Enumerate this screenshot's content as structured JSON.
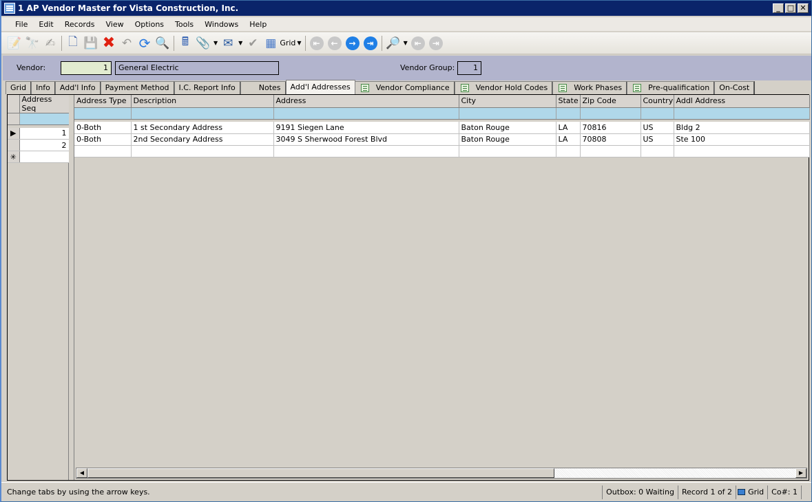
{
  "window": {
    "title": "1 AP Vendor Master for Vista Construction, Inc.",
    "minimize": "_",
    "maximize": "□",
    "close": "✕"
  },
  "menu": [
    "File",
    "Edit",
    "Records",
    "View",
    "Options",
    "Tools",
    "Windows",
    "Help"
  ],
  "toolbar": {
    "grid_label": "Grid"
  },
  "header": {
    "vendor_label": "Vendor:",
    "vendor_number": "1",
    "vendor_name": "General Electric",
    "vendor_group_label": "Vendor Group:",
    "vendor_group": "1"
  },
  "tabs": [
    {
      "label": "Grid",
      "icon": false,
      "active": false
    },
    {
      "label": "Info",
      "icon": false,
      "active": false
    },
    {
      "label": "Add'l Info",
      "icon": false,
      "active": false
    },
    {
      "label": "Payment Method",
      "icon": false,
      "active": false
    },
    {
      "label": "I.C. Report Info",
      "icon": false,
      "active": false
    },
    {
      "label": "Notes",
      "icon": false,
      "active": false
    },
    {
      "label": "Add'l Addresses",
      "icon": false,
      "active": true
    },
    {
      "label": "Vendor Compliance",
      "icon": true,
      "active": false
    },
    {
      "label": "Vendor Hold Codes",
      "icon": true,
      "active": false
    },
    {
      "label": "Work Phases",
      "icon": true,
      "active": false
    },
    {
      "label": "Pre-qualification",
      "icon": true,
      "active": false
    },
    {
      "label": "On-Cost",
      "icon": false,
      "active": false
    }
  ],
  "grid": {
    "frozen_columns": [
      "Address Seq"
    ],
    "columns": [
      "Address Type",
      "Description",
      "Address",
      "City",
      "State",
      "Zip Code",
      "Country",
      "Addl Address"
    ],
    "rows": [
      {
        "seq": "1",
        "current": true,
        "cells": [
          "0-Both",
          "1 st Secondary Address",
          "9191 Siegen Lane",
          "Baton Rouge",
          "LA",
          "70816",
          "US",
          "Bldg 2"
        ]
      },
      {
        "seq": "2",
        "current": false,
        "cells": [
          "0-Both",
          "2nd Secondary Address",
          "3049 S Sherwood Forest Blvd",
          "Baton Rouge",
          "LA",
          "70808",
          "US",
          "Ste 100"
        ]
      }
    ],
    "current_row_marker": "▶",
    "new_row_marker": "✳"
  },
  "status": {
    "message": "Change tabs by using the arrow keys.",
    "outbox": "Outbox: 0 Waiting",
    "record": "Record 1 of 2",
    "view": "Grid",
    "company": "Co#: 1"
  }
}
